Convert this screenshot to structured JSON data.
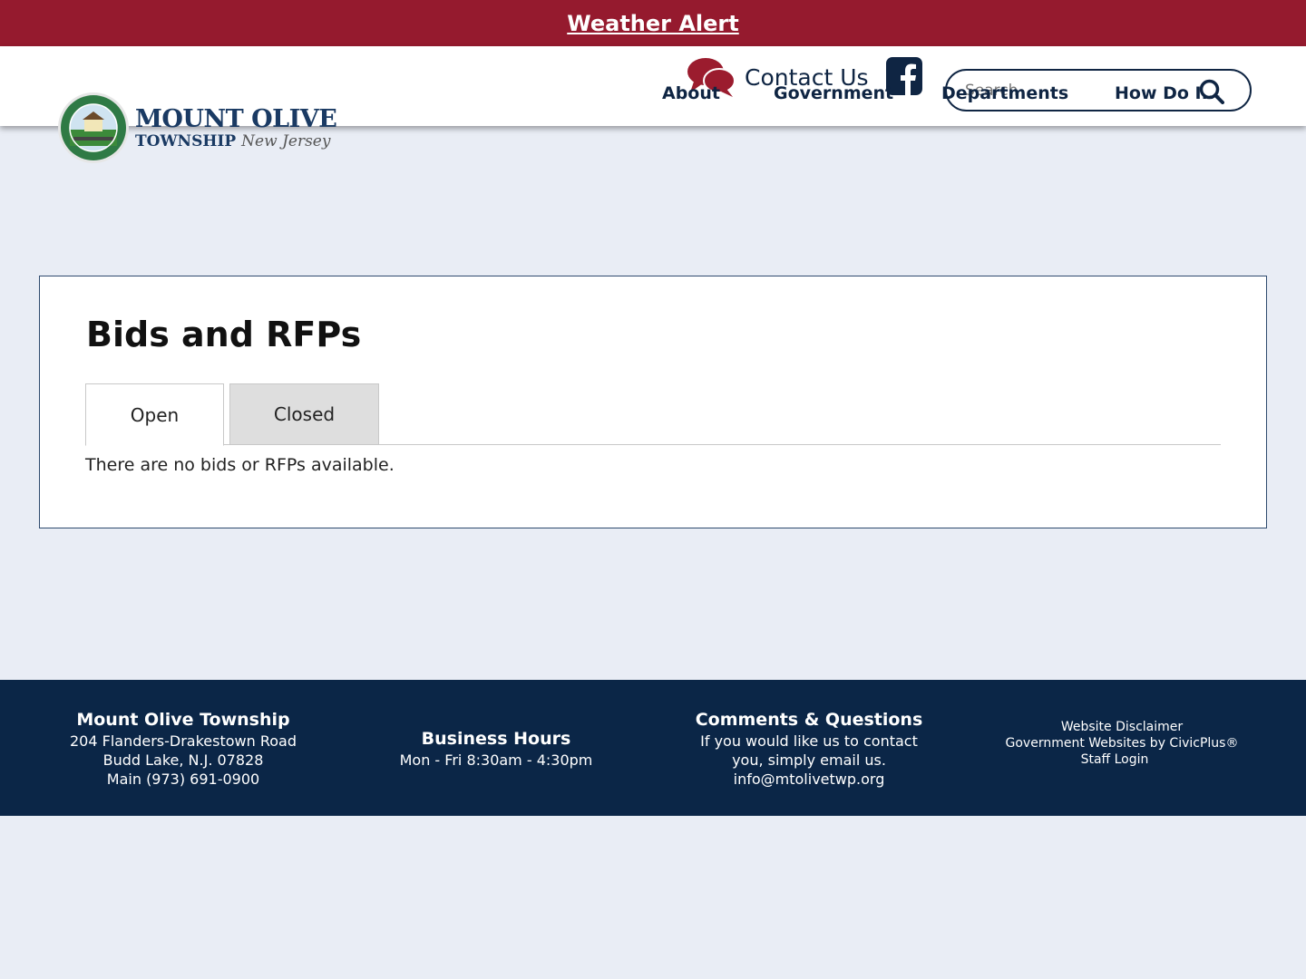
{
  "alert": {
    "label": "Weather Alert"
  },
  "header": {
    "logo": {
      "line1": "MOUNT OLIVE",
      "line2": "TOWNSHIP",
      "state": "New Jersey"
    },
    "contact_label": "Contact Us",
    "search_placeholder": "Search",
    "nav": {
      "about": "About",
      "government": "Government",
      "departments": "Departments",
      "how_do_i": "How Do I..."
    }
  },
  "main": {
    "title": "Bids and RFPs",
    "tabs": {
      "open": "Open",
      "closed": "Closed"
    },
    "empty_message": "There are no bids or RFPs available."
  },
  "footer": {
    "org": {
      "name": "Mount Olive Township",
      "address1": "204 Flanders-Drakestown Road",
      "address2": "Budd Lake, N.J. 07828",
      "phone": "Main (973) 691-0900"
    },
    "hours": {
      "title": "Business Hours",
      "text": "Mon - Fri 8:30am - 4:30pm"
    },
    "comments": {
      "title": "Comments & Questions",
      "line1": "If you would like us to contact",
      "line2": "you, simply email us.",
      "email": "info@mtolivetwp.org"
    },
    "links": {
      "disclaimer": "Website Disclaimer",
      "civicplus": "Government Websites by CivicPlus®",
      "staff_login": "Staff Login"
    }
  },
  "colors": {
    "alert": "#951a2e",
    "navy": "#0b2647",
    "page_bg": "#e9edf5",
    "accent_red": "#9b1c2e"
  }
}
